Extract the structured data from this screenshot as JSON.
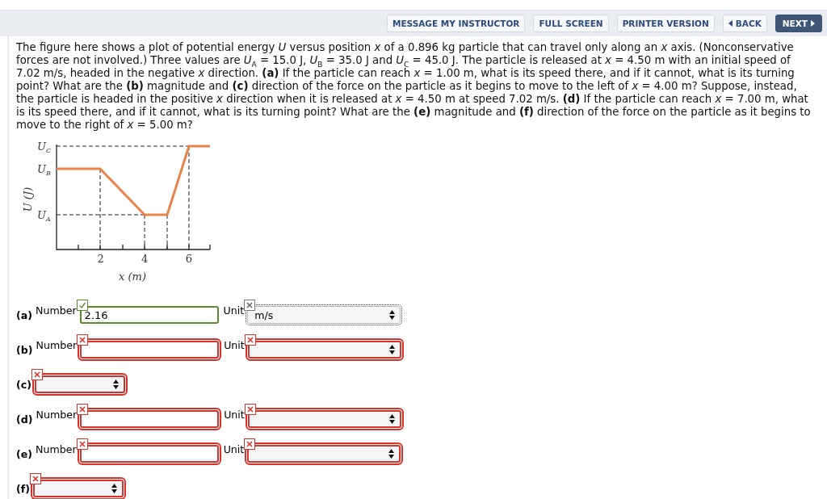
{
  "toolbar": {
    "buttons": [
      {
        "label": "MESSAGE MY INSTRUCTOR",
        "kind": "plain"
      },
      {
        "label": "FULL SCREEN",
        "kind": "plain"
      },
      {
        "label": "PRINTER VERSION",
        "kind": "plain"
      },
      {
        "label": "BACK",
        "kind": "back"
      },
      {
        "label": "NEXT",
        "kind": "next"
      }
    ]
  },
  "question": "The figure here shows a plot of potential energy *U* versus position *x* of a 0.896 kg particle that can travel only along an *x* axis. (Nonconservative forces are not involved.) Three values are *U*$_{A}$ = 15.0 J, *U*$_{B}$ = 35.0 J and *U*$_{C}$ = 45.0 J. The particle is released at *x* = 4.50 m with an initial speed of 7.02 m/s, headed in the negative *x* direction. **(a)** If the particle can reach *x* = 1.00 m, what is its speed there, and if it cannot, what is its turning point? What are the **(b)** magnitude and **(c)** direction of the force on the particle as it begins to move to the left of *x* = 4.00 m? Suppose, instead, the particle is headed in the positive *x* direction when it is released at *x* = 4.50 m at speed 7.02 m/s. **(d)** If the particle can reach *x* = 7.00 m, what is its speed there, and if it cannot, what is its turning point? What are the **(e)** magnitude and **(f)** direction of the force on the particle as it begins to move to the right of *x* = 5.00 m?",
  "figure": {
    "ylabel": "U (J)",
    "xlabel": "x (m)",
    "y_labels": [
      {
        "symbol": "U",
        "sub": "C"
      },
      {
        "symbol": "U",
        "sub": "B"
      },
      {
        "symbol": "U",
        "sub": "A"
      }
    ],
    "x_ticks": [
      "2",
      "4",
      "6"
    ]
  },
  "answers": [
    {
      "label": "(a)",
      "kind": "number-unit",
      "number_label": "Number",
      "number": {
        "value": "2.16",
        "graded": true,
        "correct": true
      },
      "unit_label": "Unit",
      "unit": {
        "value": "m/s",
        "graded": false
      }
    },
    {
      "label": "(b)",
      "kind": "number-unit",
      "number_label": "Number",
      "number": {
        "graded": true,
        "correct": false
      },
      "unit_label": "Unit",
      "unit": {
        "graded": true,
        "correct": false
      }
    },
    {
      "label": "(c)",
      "kind": "select",
      "choice": {
        "graded": true,
        "correct": false
      }
    },
    {
      "label": "(d)",
      "kind": "number-unit",
      "number_label": "Number",
      "number": {
        "graded": true,
        "correct": false
      },
      "unit_label": "Unit",
      "unit": {
        "graded": true,
        "correct": false
      }
    },
    {
      "label": "(e)",
      "kind": "number-unit",
      "number_label": "Number",
      "number": {
        "graded": true,
        "correct": false
      },
      "unit_label": "Unit",
      "unit": {
        "graded": true,
        "correct": false
      }
    },
    {
      "label": "(f)",
      "kind": "select",
      "choice": {
        "graded": true,
        "correct": false
      }
    }
  ]
}
